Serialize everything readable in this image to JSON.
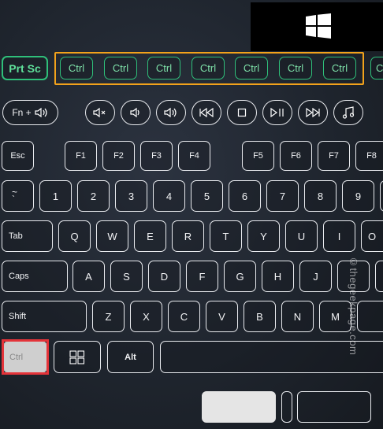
{
  "keys": {
    "prtsc": "Prt Sc",
    "ctrl": "Ctrl",
    "fn": "Fn +",
    "esc": "Esc",
    "f1": "F1",
    "f2": "F2",
    "f3": "F3",
    "f4": "F4",
    "f5": "F5",
    "f6": "F6",
    "f7": "F7",
    "f8": "F8",
    "tilde": "~",
    "n1": "1",
    "n2": "2",
    "n3": "3",
    "n4": "4",
    "n5": "5",
    "n6": "6",
    "n7": "7",
    "n8": "8",
    "n9": "9",
    "tab": "Tab",
    "q": "Q",
    "w": "W",
    "e": "E",
    "r": "R",
    "t": "T",
    "y": "Y",
    "u": "U",
    "i": "I",
    "caps": "Caps",
    "a": "A",
    "s": "S",
    "d": "D",
    "f": "F",
    "g": "G",
    "h": "H",
    "j": "J",
    "shift": "Shift",
    "z": "Z",
    "x": "X",
    "c": "C",
    "v": "V",
    "b": "B",
    "n": "N",
    "m": "M",
    "alt": "Alt"
  },
  "colors": {
    "highlight_orange": "#f2a21b",
    "highlight_red": "#e4343a",
    "green_key": "#2fbf7a"
  },
  "icons": {
    "windows_logo": "windows-logo-icon",
    "speaker": "speaker-icon",
    "mute": "mute-icon",
    "volume_down": "volume-down-icon",
    "volume_up": "volume-up-icon",
    "prev_track": "previous-track-icon",
    "stop": "stop-icon",
    "play_pause": "play-pause-icon",
    "next_track": "next-track-icon",
    "music": "music-note-icon",
    "windows_key": "windows-key-icon"
  },
  "watermark": "©thegeekpage.com"
}
